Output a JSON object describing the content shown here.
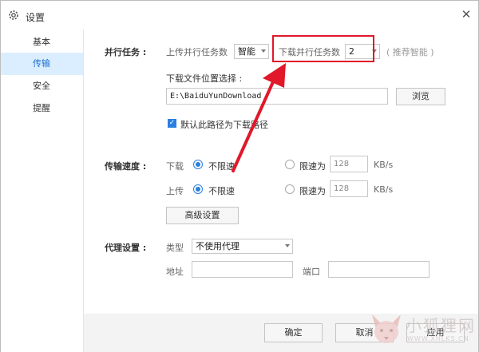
{
  "window": {
    "title": "设置",
    "close_glyph": "✕"
  },
  "sidebar": {
    "items": [
      {
        "label": "基本"
      },
      {
        "label": "传输"
      },
      {
        "label": "安全"
      },
      {
        "label": "提醒"
      }
    ],
    "active_index": 1
  },
  "parallel": {
    "section_label": "并行任务 :",
    "upload_label": "上传并行任务数",
    "upload_value": "智能",
    "download_label": "下载并行任务数",
    "download_value": "2",
    "hint": "( 推荐智能 )"
  },
  "download_location": {
    "label": "下载文件位置选择 :",
    "path": "E:\\BaiduYunDownload",
    "browse_label": "浏览",
    "default_checkbox_label": "默认此路径为下载路径",
    "default_checked": true
  },
  "speed": {
    "section_label": "传输速度 :",
    "download": {
      "label": "下载",
      "unlimited_label": "不限速",
      "limited_label": "限速为",
      "limit_value": "128",
      "unit": "KB/s",
      "selected": "unlimited"
    },
    "upload": {
      "label": "上传",
      "unlimited_label": "不限速",
      "limited_label": "限速为",
      "limit_value": "128",
      "unit": "KB/s",
      "selected": "unlimited"
    },
    "advanced_label": "高级设置"
  },
  "proxy": {
    "section_label": "代理设置 :",
    "type_label": "类型",
    "type_value": "不使用代理",
    "address_label": "地址",
    "address_value": "",
    "port_label": "端口",
    "port_value": ""
  },
  "footer": {
    "ok_label": "确定",
    "cancel_label": "取消",
    "apply_label": "应用"
  },
  "watermark": {
    "text": "小狐狸网",
    "sub": "WWW.XHLKS.CN"
  },
  "colors": {
    "accent": "#2a7fe0",
    "annotation": "#e0182a",
    "active_nav_bg": "#dbeeff"
  },
  "icons": {
    "title": "gear-icon",
    "close": "close-icon",
    "annotation": "arrow-annotation"
  }
}
